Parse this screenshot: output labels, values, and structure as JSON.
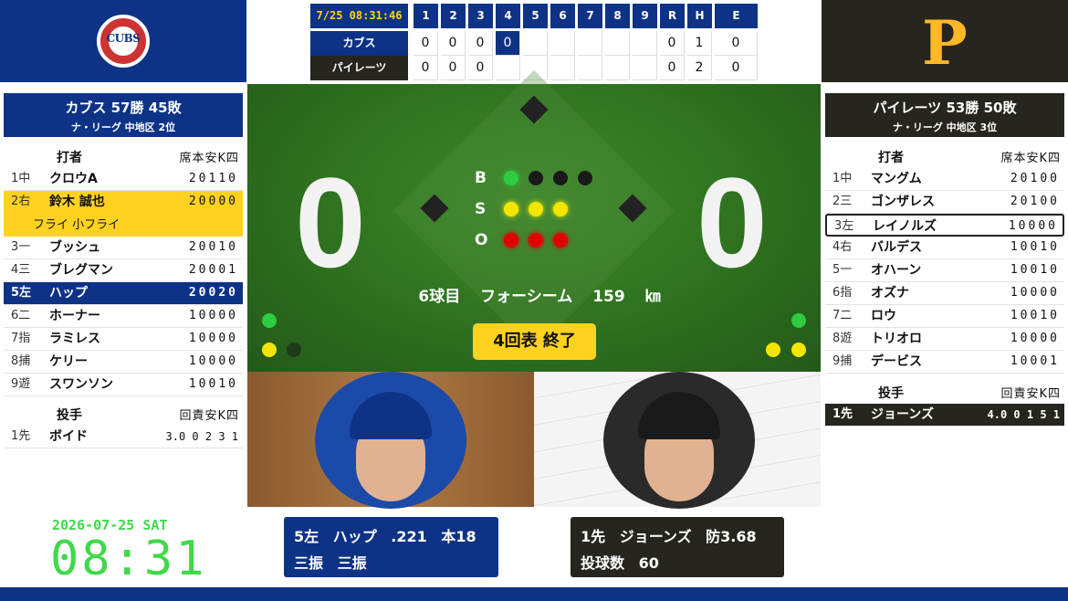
{
  "colors": {
    "home": "#0e3386",
    "away": "#27251f",
    "highlight": "#ffd21f",
    "field": "#2d6e1e",
    "ball": "#2ecc40",
    "strike": "#f2e600",
    "out": "#e00000",
    "clock": "#3fd94a"
  },
  "home_logo": {
    "icon": "cubs-logo-icon",
    "text": "CUBS"
  },
  "away_logo": {
    "icon": "pirates-logo-icon",
    "text": "P"
  },
  "scoreboard": {
    "time": "7/25 08:31:46",
    "innings": [
      "1",
      "2",
      "3",
      "4",
      "5",
      "6",
      "7",
      "8",
      "9"
    ],
    "rhe": [
      "R",
      "H",
      "E"
    ],
    "teams": [
      {
        "name": "カブス",
        "scores": [
          "0",
          "0",
          "0",
          "0",
          "",
          "",
          "",
          "",
          "",
          ""
        ],
        "r": "0",
        "h": "1",
        "e": "0"
      },
      {
        "name": "パイレーツ",
        "scores": [
          "0",
          "0",
          "0",
          "",
          "",
          "",
          "",
          "",
          "",
          ""
        ],
        "r": "0",
        "h": "2",
        "e": "0"
      }
    ]
  },
  "home": {
    "record": "カブス 57勝 45敗",
    "league": "ナ・リーグ 中地区 2位",
    "batter_head": "打者",
    "batter_cols": "席本安K四",
    "batters": [
      {
        "pos": "1中",
        "name": "クロウA",
        "stats": "20110"
      },
      {
        "pos": "2右",
        "name": "鈴木 誠也",
        "stats": "20000",
        "note": "フライ 小フライ"
      },
      {
        "pos": "3一",
        "name": "ブッシュ",
        "stats": "20010"
      },
      {
        "pos": "4三",
        "name": "ブレグマン",
        "stats": "20001"
      },
      {
        "pos": "5左",
        "name": "ハップ",
        "stats": "20020"
      },
      {
        "pos": "6二",
        "name": "ホーナー",
        "stats": "10000"
      },
      {
        "pos": "7指",
        "name": "ラミレス",
        "stats": "10000"
      },
      {
        "pos": "8捕",
        "name": "ケリー",
        "stats": "10000"
      },
      {
        "pos": "9遊",
        "name": "スワンソン",
        "stats": "10010"
      }
    ],
    "pitcher_head": "投手",
    "pitcher_cols": "回責安K四",
    "pitchers": [
      {
        "pos": "1先",
        "name": "ボイド",
        "stats": "3.0 0 2 3 1"
      }
    ]
  },
  "away": {
    "record": "パイレーツ 53勝 50敗",
    "league": "ナ・リーグ 中地区 3位",
    "batter_head": "打者",
    "batter_cols": "席本安K四",
    "batters": [
      {
        "pos": "1中",
        "name": "マングム",
        "stats": "20100"
      },
      {
        "pos": "2三",
        "name": "ゴンザレス",
        "stats": "20100"
      },
      {
        "pos": "3左",
        "name": "レイノルズ",
        "stats": "10000"
      },
      {
        "pos": "4右",
        "name": "バルデス",
        "stats": "10010"
      },
      {
        "pos": "5一",
        "name": "オハーン",
        "stats": "10010"
      },
      {
        "pos": "6指",
        "name": "オズナ",
        "stats": "10000"
      },
      {
        "pos": "7二",
        "name": "ロウ",
        "stats": "10010"
      },
      {
        "pos": "8遊",
        "name": "トリオロ",
        "stats": "10000"
      },
      {
        "pos": "9捕",
        "name": "デービス",
        "stats": "10001"
      }
    ],
    "pitcher_head": "投手",
    "pitcher_cols": "回責安K四",
    "pitchers": [
      {
        "pos": "1先",
        "name": "ジョーンズ",
        "stats": "4.0 0 1 5 1"
      }
    ]
  },
  "field": {
    "home_score": "0",
    "away_score": "0",
    "count_labels": [
      "B",
      "S",
      "O"
    ],
    "balls": 1,
    "strikes": 3,
    "outs": 3,
    "pitch_info": "6球目 フォーシーム 159 ㎞",
    "inning_status": "4回表 終了",
    "left_runners": {
      "ball": 1,
      "strike": 1
    },
    "right_runners": {
      "ball": 1,
      "strike": 2
    }
  },
  "batter_info": {
    "line1": "5左 ハップ .221 本18",
    "line2": "三振 三振"
  },
  "pitcher_info": {
    "line1": "1先 ジョーンズ 防3.68",
    "line2": "投球数 60"
  },
  "clock": {
    "date": "2026-07-25 SAT",
    "time": "08:31"
  }
}
